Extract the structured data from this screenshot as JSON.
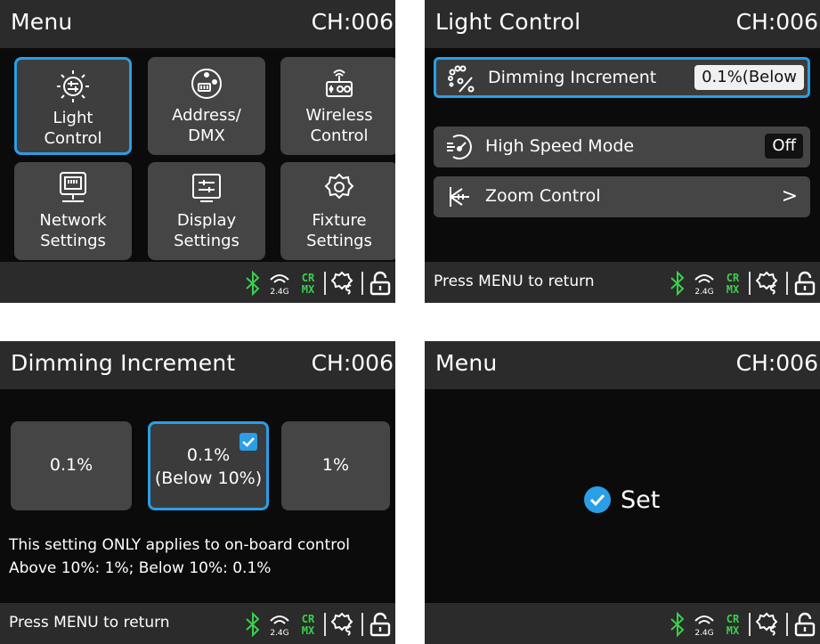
{
  "channel": "CH:006",
  "accent_color": "#2a9ee6",
  "status_icons": [
    "bluetooth-icon",
    "wireless-2.4g-icon",
    "crmx-icon",
    "gear-cs-icon",
    "unlock-icon"
  ],
  "status_labels": {
    "ghz": "2.4G",
    "crmx_top": "CR",
    "crmx_bottom": "MX"
  },
  "screen_menu": {
    "title": "Menu",
    "tiles": [
      {
        "line1": "Light",
        "line2": "Control",
        "icon": "light-control-icon",
        "selected": true
      },
      {
        "line1": "Address/",
        "line2": "DMX",
        "icon": "dmx-connector-icon",
        "selected": false
      },
      {
        "line1": "Wireless",
        "line2": "Control",
        "icon": "wireless-control-icon",
        "selected": false
      },
      {
        "line1": "Network",
        "line2": "Settings",
        "icon": "network-icon",
        "selected": false
      },
      {
        "line1": "Display",
        "line2": "Settings",
        "icon": "display-icon",
        "selected": false
      },
      {
        "line1": "Fixture",
        "line2": "Settings",
        "icon": "gear-icon",
        "selected": false
      }
    ]
  },
  "screen_light": {
    "title": "Light Control",
    "return_hint": "Press MENU to return",
    "rows": [
      {
        "label": "Dimming Increment",
        "value": "0.1%(Below",
        "icon": "dimming-percent-icon"
      },
      {
        "label": "High Speed Mode",
        "value": "Off",
        "icon": "speed-icon"
      },
      {
        "label": "Zoom Control",
        "value": ">",
        "icon": "zoom-icon"
      }
    ]
  },
  "screen_dimming": {
    "title": "Dimming Increment",
    "return_hint": "Press MENU to return",
    "options": [
      {
        "line1": "0.1%",
        "line2": ""
      },
      {
        "line1": "0.1%",
        "line2": "(Below 10%)"
      },
      {
        "line1": "1%",
        "line2": ""
      }
    ],
    "selected_index": 1,
    "note_line1": "This setting ONLY applies to on-board control",
    "note_line2": "Above 10%: 1%; Below 10%: 0.1%"
  },
  "screen_set": {
    "title": "Menu",
    "message": "Set"
  }
}
